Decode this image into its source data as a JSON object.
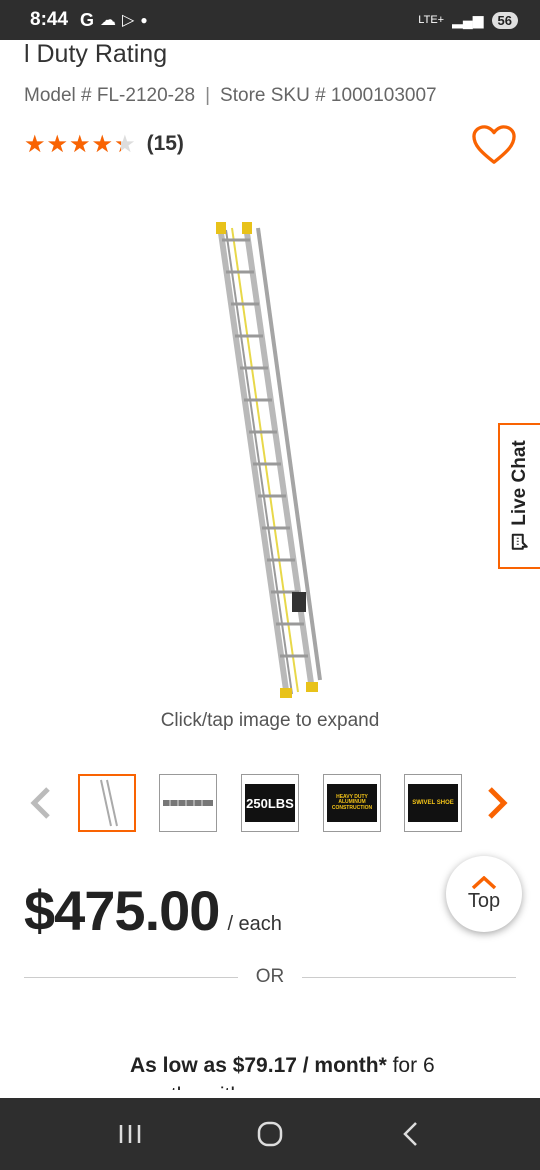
{
  "status_bar": {
    "time": "8:44",
    "left_icons": [
      "google-g-icon",
      "cloud-icon",
      "play-store-icon",
      "dot-icon"
    ],
    "network": "LTE+",
    "battery": "56"
  },
  "product": {
    "title_fragment": "l Duty Rating",
    "model_label": "Model # FL-2120-28",
    "sku_label": "Store SKU # 1000103007",
    "rating": {
      "stars": "★★★★★",
      "value": 4.3,
      "max": 5,
      "review_count": "(15)"
    },
    "expand_hint": "Click/tap image to expand",
    "price": "$475.00",
    "price_unit": "/ each"
  },
  "gallery": {
    "thumbnails": [
      {
        "label": "",
        "kind": "ladder"
      },
      {
        "label": "",
        "kind": "ladder-horizontal"
      },
      {
        "label": "250LBS",
        "kind": "badge"
      },
      {
        "label": "HEAVY DUTY ALUMINUM CONSTRUCTION",
        "kind": "badge"
      },
      {
        "label": "SWIVEL SHOE",
        "kind": "badge"
      }
    ],
    "active_index": 0
  },
  "top_button": {
    "label": "Top"
  },
  "divider": {
    "label": "OR"
  },
  "financing": {
    "bold_text": "As low as $79.17 / month*",
    "suffix": " for 6",
    "line2": "months with..."
  },
  "live_chat": {
    "label": "Live Chat"
  },
  "colors": {
    "accent": "#f96302",
    "status_bar": "#2e2e2e"
  }
}
